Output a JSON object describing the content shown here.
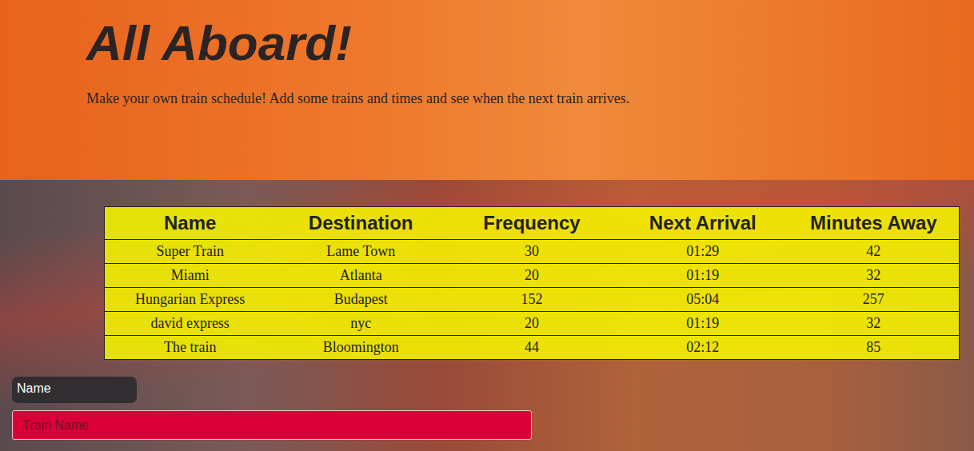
{
  "header": {
    "title": "All Aboard!",
    "subtitle": "Make your own train schedule! Add some trains and times and see when the next train arrives."
  },
  "table": {
    "columns": [
      "Name",
      "Destination",
      "Frequency",
      "Next Arrival",
      "Minutes Away"
    ],
    "rows": [
      [
        "Super Train",
        "Lame Town",
        "30",
        "01:29",
        "42"
      ],
      [
        "Miami",
        "Atlanta",
        "20",
        "01:19",
        "32"
      ],
      [
        "Hungarian Express",
        "Budapest",
        "152",
        "05:04",
        "257"
      ],
      [
        "david express",
        "nyc",
        "20",
        "01:19",
        "32"
      ],
      [
        "The train",
        "Bloomington",
        "44",
        "02:12",
        "85"
      ]
    ]
  },
  "form": {
    "label": "Name",
    "placeholder": "Train Name"
  }
}
